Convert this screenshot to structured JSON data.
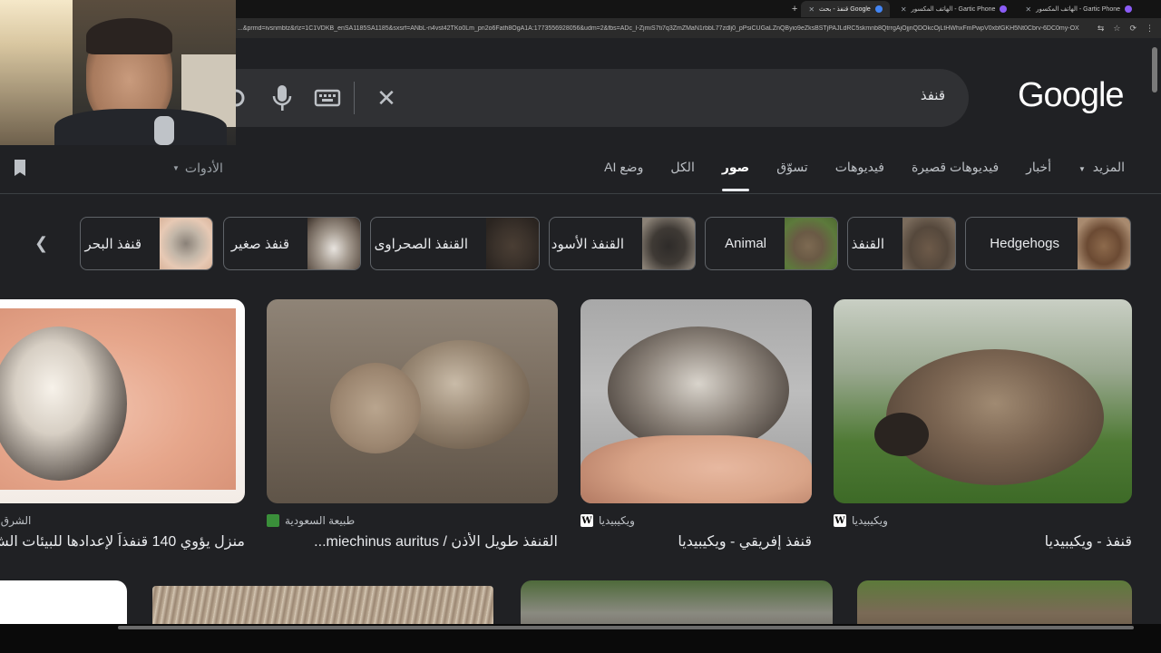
{
  "browser": {
    "tabs": [
      {
        "label": "الهاتف المكسور - Gartic Phone",
        "active": false
      },
      {
        "label": "الهاتف المكسور - Gartic Phone",
        "active": false
      },
      {
        "label": "قنفذ - بحث Google",
        "active": true
      }
    ],
    "new_tab": "+",
    "url": "...&prmd=ivsnmbtz&rlz=1C1VDKB_enSA1185SA1185&sxsrf=ANbL-n4vst42TKo0Lm_pn2o6Fath8OgA1A:1773556928056&udm=2&fbs=ADc_l-ZjmiS7ti7q3ZmZMaN1rbbL77zdlj0_pPsiCUGaLZnQByio9eZksBSTjPAJLdRC5skmnb8QtrrgAjOjjnQDOkcOjLtHWhxFmPwpV0xbfGKH5Nt0Cbrv-6DC0my-OXT3QfrYKbbfKiGll7RUbJkuGGN..."
  },
  "logo": "Google",
  "search": {
    "query": "قنفذ"
  },
  "nav": {
    "tabs": [
      {
        "label": "وضع AI",
        "active": false
      },
      {
        "label": "الكل",
        "active": false
      },
      {
        "label": "صور",
        "active": true
      },
      {
        "label": "تسوّق",
        "active": false
      },
      {
        "label": "فيديوهات",
        "active": false
      },
      {
        "label": "فيديوهات قصيرة",
        "active": false
      },
      {
        "label": "أخبار",
        "active": false
      },
      {
        "label": "المزيد",
        "active": false
      }
    ],
    "tools": "الأدوات"
  },
  "chips": [
    {
      "label": "Hedgehogs"
    },
    {
      "label": "القنفذ"
    },
    {
      "label": "Animal"
    },
    {
      "label": "القنفذ الأسود"
    },
    {
      "label": "القنفذ الصحراوى"
    },
    {
      "label": "قنفذ صغير"
    },
    {
      "label": "قنفذ البحر"
    }
  ],
  "results": [
    {
      "source": "ويكيبيديا",
      "source_icon": "W",
      "title": "قنفذ - ويكيبيديا"
    },
    {
      "source": "ويكيبيديا",
      "source_icon": "W",
      "title": "قنفذ إفريقي - ويكيبيديا"
    },
    {
      "source": "طبيعة السعودية",
      "source_icon": "",
      "title": "القنفذ طويل الأذن / miechinus auritus..."
    },
    {
      "source": "الشرق الأوسط",
      "source_icon": "",
      "title": "منزل يؤوي 140 قنفذاً لإعدادها للبيئات الش"
    }
  ],
  "colors": {
    "background": "#202124",
    "search_box": "#303134",
    "chip_border": "#5f6368",
    "active_tab": "#ffffff"
  }
}
